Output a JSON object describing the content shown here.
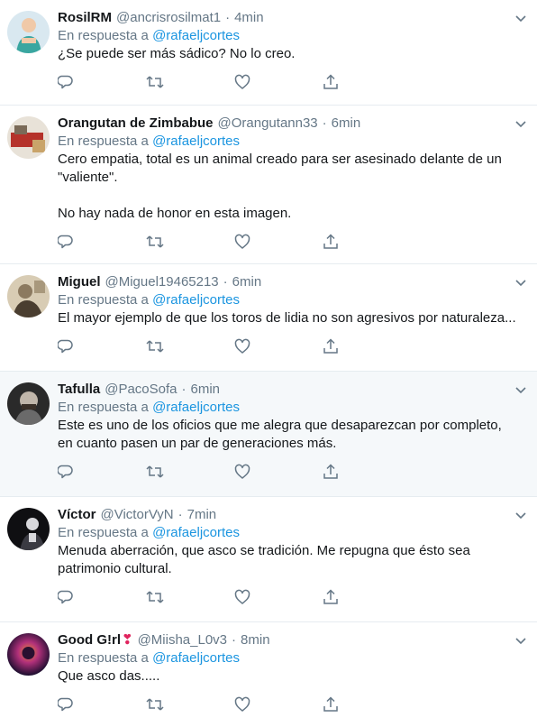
{
  "reply_prefix": "En respuesta a",
  "tweets": [
    {
      "name": "RosilRM",
      "handle": "@ancrisrosilmat1",
      "time": "4min",
      "mention": "@rafaeljcortes",
      "text": "¿Se puede ser más sádico? No lo creo.",
      "avatar_colors": [
        "#d9e8f0",
        "#3aa6a0",
        "#f0c9a8"
      ]
    },
    {
      "name": "Orangutan de Zimbabue",
      "handle": "@Orangutann33",
      "time": "6min",
      "mention": "@rafaeljcortes",
      "text": "Cero empatia, total es un animal creado para ser asesinado delante de un \"valiente\".\n\nNo hay nada de honor en esta imagen.",
      "avatar_colors": [
        "#e8e2d8",
        "#b5322a",
        "#7a6a58"
      ]
    },
    {
      "name": "Miguel",
      "handle": "@Miguel19465213",
      "time": "6min",
      "mention": "@rafaeljcortes",
      "text": "El mayor ejemplo de que los toros de lidia no son agresivos por naturaleza...",
      "avatar_colors": [
        "#8c7a60",
        "#d8ccb4",
        "#4a3e30"
      ]
    },
    {
      "name": "Tafulla",
      "handle": "@PacoSofa",
      "time": "6min",
      "mention": "@rafaeljcortes",
      "text": "Este es uno de los oficios que me alegra que desaparezcan por completo, en cuanto pasen un par de generaciones más.",
      "avatar_colors": [
        "#2a2a2a",
        "#6a6a6a",
        "#c0b6aa"
      ]
    },
    {
      "name": "Víctor",
      "handle": "@VictorVyN",
      "time": "7min",
      "mention": "@rafaeljcortes",
      "text": "Menuda aberración, que asco se tradición. Me repugna que ésto sea patrimonio cultural.",
      "avatar_colors": [
        "#0f0f12",
        "#3a3a42",
        "#d8d8dc"
      ]
    },
    {
      "name": "Good G!rl",
      "handle": "@Miisha_L0v3",
      "time": "8min",
      "mention": "@rafaeljcortes",
      "text": "Que asco das.....",
      "avatar_colors": [
        "#1a0d2e",
        "#b0307a",
        "#f08a3a"
      ]
    }
  ],
  "icons": [
    "reply-icon",
    "retweet-icon",
    "like-icon",
    "share-icon",
    "caret-down-icon",
    "heart-emoji-icon"
  ],
  "colors": {
    "accent": "#1b95e0",
    "muted": "#657786",
    "divider": "#e6ecf0",
    "hover_bg": "#f5f8fa",
    "heart": "#e0245e"
  }
}
